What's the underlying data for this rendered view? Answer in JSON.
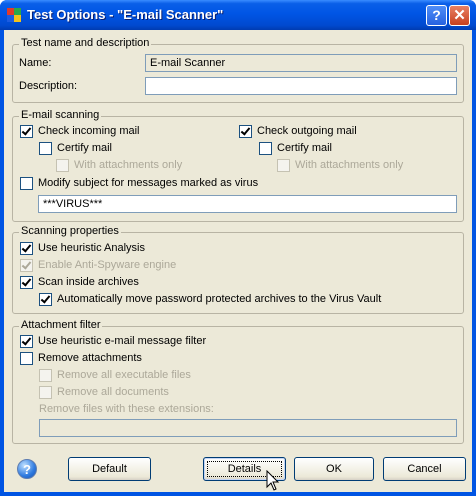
{
  "window": {
    "title": "Test Options - \"E-mail Scanner\"",
    "help_glyph": "?",
    "close_glyph": "✕"
  },
  "test_name_group": {
    "legend": "Test name and description",
    "name_label": "Name:",
    "name_value": "E-mail Scanner",
    "description_label": "Description:",
    "description_value": ""
  },
  "email_scanning": {
    "legend": "E-mail scanning",
    "check_incoming": {
      "label": "Check incoming mail",
      "checked": true
    },
    "certify_incoming": {
      "label": "Certify mail",
      "checked": false
    },
    "attach_incoming": {
      "label": "With attachments only",
      "checked": false,
      "disabled": true
    },
    "check_outgoing": {
      "label": "Check outgoing mail",
      "checked": true
    },
    "certify_outgoing": {
      "label": "Certify mail",
      "checked": false
    },
    "attach_outgoing": {
      "label": "With attachments only",
      "checked": false,
      "disabled": true
    },
    "modify_subject": {
      "label": "Modify subject for messages marked as virus",
      "checked": false
    },
    "subject_value": "***VIRUS***"
  },
  "scanning_properties": {
    "legend": "Scanning properties",
    "heuristic": {
      "label": "Use heuristic Analysis",
      "checked": true
    },
    "anti_spyware": {
      "label": "Enable Anti-Spyware engine",
      "checked": true,
      "disabled": true
    },
    "scan_archives": {
      "label": "Scan inside archives",
      "checked": true
    },
    "move_password": {
      "label": "Automatically move password protected archives to the Virus Vault",
      "checked": true
    }
  },
  "attachment_filter": {
    "legend": "Attachment filter",
    "heuristic_filter": {
      "label": "Use heuristic e-mail message filter",
      "checked": true
    },
    "remove_attachments": {
      "label": "Remove attachments",
      "checked": false
    },
    "remove_executables": {
      "label": "Remove all executable files",
      "checked": false,
      "disabled": true
    },
    "remove_documents": {
      "label": "Remove all documents",
      "checked": false,
      "disabled": true
    },
    "extensions_label": "Remove files with these extensions:",
    "extensions_value": ""
  },
  "buttons": {
    "help_glyph": "?",
    "default": "Default",
    "details": "Details",
    "ok": "OK",
    "cancel": "Cancel"
  },
  "colors": {
    "titlebar": "#0055e5",
    "dialog_bg": "#ece9d8",
    "disabled_text": "#aca899"
  }
}
